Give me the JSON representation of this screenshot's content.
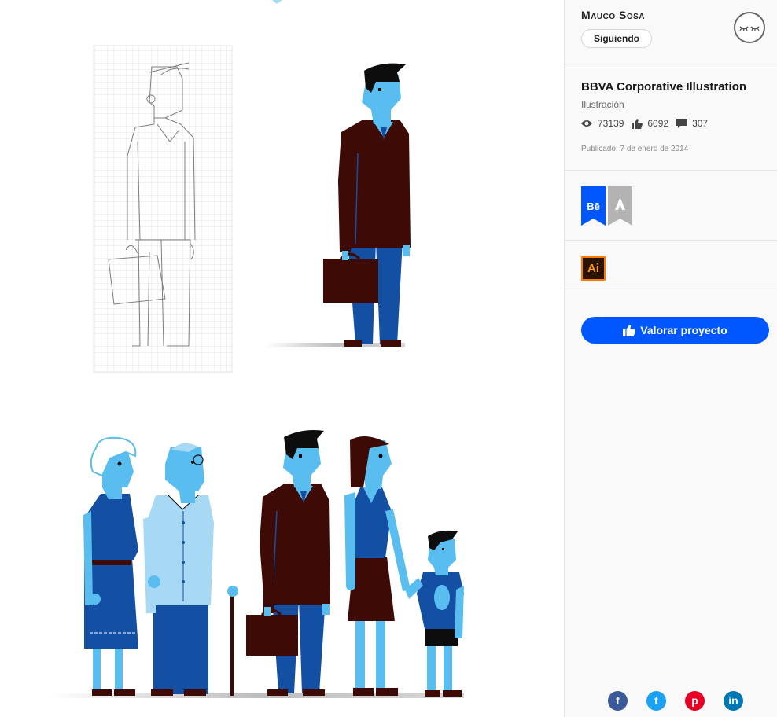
{
  "owner": {
    "name": "Mauco Sosa",
    "follow_label": "Siguiendo"
  },
  "project": {
    "title": "BBVA Corporative Illustration",
    "category": "Ilustración",
    "views": "73139",
    "appreciations": "6092",
    "comments": "307",
    "published": "Publicado: 7 de enero de 2014"
  },
  "tools": {
    "behance_label": "Bē",
    "adobe_label": "A",
    "illustrator_label": "Ai"
  },
  "actions": {
    "appreciate_label": "Valorar proyecto"
  },
  "share": {
    "facebook": "f",
    "twitter": "t",
    "pinterest": "p",
    "linkedin": "in"
  },
  "colors": {
    "accent": "#0057ff",
    "skin": "#59bdf0",
    "jacket": "#3e0a05",
    "pants": "#134fa3",
    "light_shirt": "#a7d9f4",
    "hair": "#0d0d0d",
    "facebook": "#3b5998",
    "twitter": "#1da1f2",
    "pinterest": "#e60023",
    "linkedin": "#0077b5"
  }
}
